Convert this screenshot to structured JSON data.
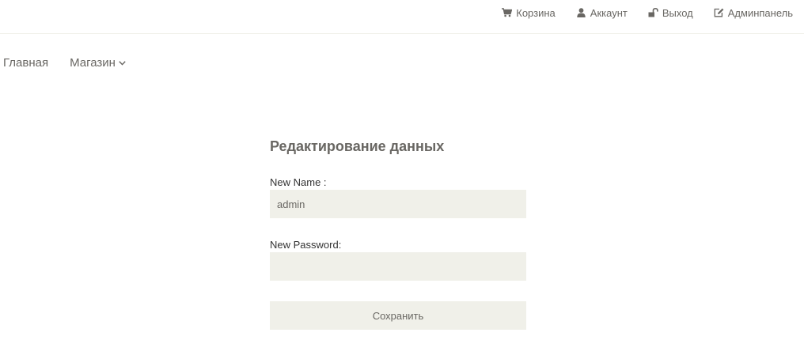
{
  "header": {
    "links": [
      {
        "label": "Корзина",
        "icon": "shopping-cart-icon"
      },
      {
        "label": "Аккаунт",
        "icon": "user-icon"
      },
      {
        "label": "Выход",
        "icon": "unlock-icon"
      },
      {
        "label": "Админпанель",
        "icon": "edit-icon"
      }
    ]
  },
  "nav": {
    "items": [
      {
        "label": "Главная"
      },
      {
        "label": "Магазин",
        "icon": "chevron-down-icon"
      }
    ]
  },
  "form": {
    "title": "Редактирование данных",
    "name_label": "New Name :",
    "name_value": "admin",
    "password_label": "New Password:",
    "password_value": "",
    "submit_label": "Сохранить"
  },
  "colors": {
    "text": "#696763",
    "field_bg": "#f0f0e9",
    "label_text": "#333333"
  }
}
